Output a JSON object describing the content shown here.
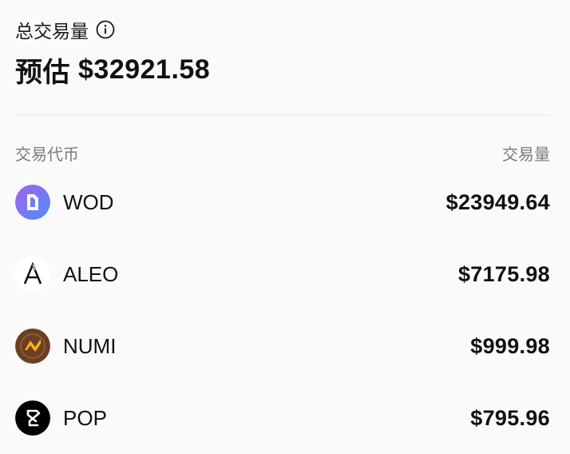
{
  "summary": {
    "label": "总交易量",
    "total_prefix": "预估",
    "total_value": "$32921.58"
  },
  "columns": {
    "token": "交易代币",
    "volume": "交易量"
  },
  "tokens": [
    {
      "symbol": "WOD",
      "volume": "$23949.64",
      "icon": "wod-logo-icon"
    },
    {
      "symbol": "ALEO",
      "volume": "$7175.98",
      "icon": "aleo-logo-icon"
    },
    {
      "symbol": "NUMI",
      "volume": "$999.98",
      "icon": "numi-logo-icon"
    },
    {
      "symbol": "POP",
      "volume": "$795.96",
      "icon": "pop-logo-icon"
    }
  ],
  "colors": {
    "background": "#fafafa",
    "text": "#111111",
    "muted": "#7a7a7a",
    "divider": "#e6e6e6",
    "wod_gradient_start": "#8b6cf0",
    "wod_gradient_end": "#4f8ef7",
    "numi_brown": "#6b3f22",
    "numi_yellow": "#f5b21a"
  }
}
